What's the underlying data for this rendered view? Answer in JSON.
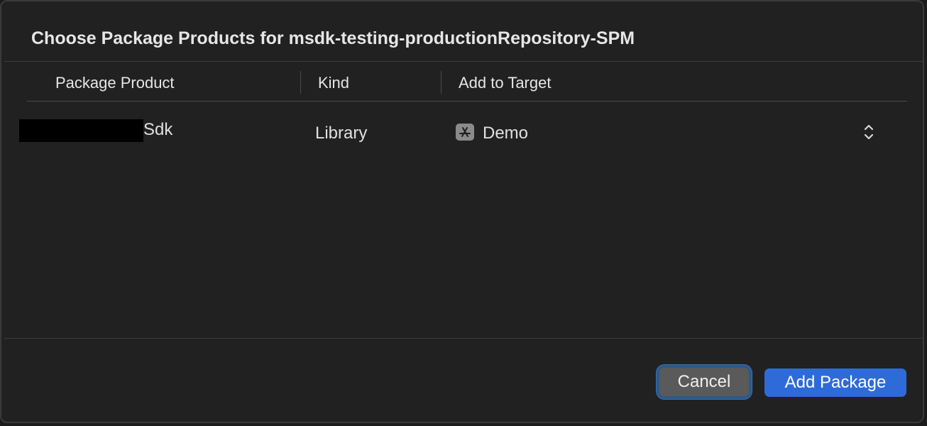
{
  "dialog": {
    "title": "Choose Package Products for msdk-testing-productionRepository-SPM"
  },
  "table": {
    "columns": [
      "Package Product",
      "Kind",
      "Add to Target"
    ],
    "rows": [
      {
        "product_suffix": "Sdk",
        "kind": "Library",
        "target": "Demo",
        "target_icon": "app-store-icon"
      }
    ]
  },
  "buttons": {
    "cancel": "Cancel",
    "add_package": "Add Package"
  },
  "colors": {
    "primary_button": "#2f6bd8",
    "focus_ring": "#2a5a8c",
    "background": "#212121"
  }
}
